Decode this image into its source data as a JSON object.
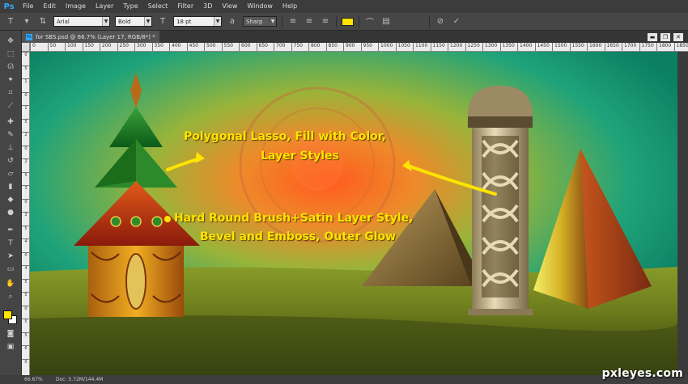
{
  "app": {
    "logo": "Ps"
  },
  "menu": [
    "File",
    "Edit",
    "Image",
    "Layer",
    "Type",
    "Select",
    "Filter",
    "3D",
    "View",
    "Window",
    "Help"
  ],
  "options": {
    "tool_icon": "T",
    "font_family": "Arial",
    "font_style": "Bold",
    "font_size": "18 pt",
    "antialias": "Sharp",
    "text_color": "#ffe400"
  },
  "document": {
    "tab_title": "for SBS.psd @ 66.7% (Layer 17, RGB/8*) *",
    "tab_icon": "Ps"
  },
  "window_controls": {
    "minimize": "▬",
    "restore": "❐",
    "close": "✕"
  },
  "ruler_top_ticks": [
    "0",
    "50",
    "100",
    "150",
    "200",
    "250",
    "300",
    "350",
    "400",
    "450",
    "500",
    "550",
    "600",
    "650",
    "700",
    "750",
    "800",
    "850",
    "900",
    "950",
    "1000",
    "1050",
    "1100",
    "1150",
    "1200",
    "1250",
    "1300",
    "1350",
    "1400",
    "1450",
    "1500",
    "1550",
    "1600",
    "1650",
    "1700",
    "1750",
    "1800",
    "1850"
  ],
  "ruler_left_ticks": [
    "0",
    "5",
    "1",
    "0",
    "1",
    "5",
    "2",
    "0",
    "2",
    "5",
    "3",
    "0",
    "3",
    "5",
    "4",
    "0",
    "4",
    "5",
    "5",
    "0",
    "5",
    "5",
    "6",
    "0"
  ],
  "annotations": {
    "line1a": "Polygonal Lasso, Fill with Color,",
    "line1b": "Layer Styles",
    "line2a": "Hard Round Brush+Satin Layer Style,",
    "line2b": "Bevel and Emboss, Outer Glow"
  },
  "status": {
    "zoom": "66.67%",
    "doc_info": "Doc: 5.72M/144.4M"
  },
  "watermark": "pxleyes.com",
  "colors": {
    "accent": "#ffe400",
    "ps_blue": "#31a8ff"
  }
}
